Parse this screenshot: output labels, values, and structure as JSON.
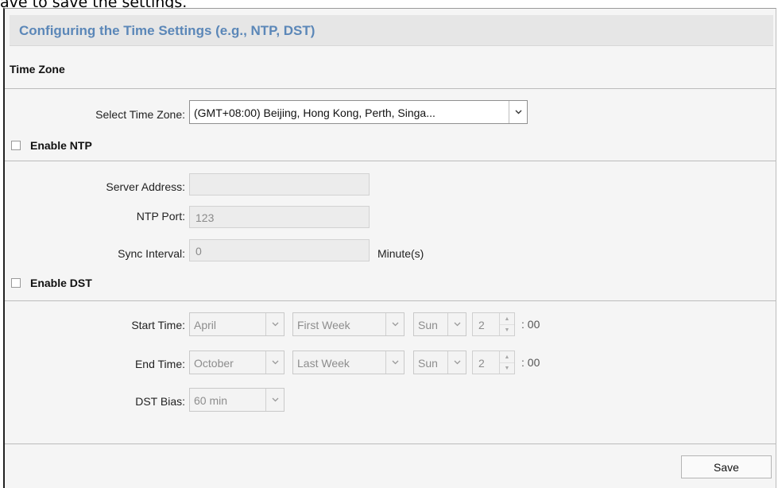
{
  "caption": "ave to save the settings.",
  "header": {
    "title": "Configuring the Time Settings (e.g., NTP, DST)"
  },
  "time_zone": {
    "section_title": "Time Zone",
    "label": "Select Time Zone:",
    "value": "(GMT+08:00) Beijing, Hong Kong, Perth, Singa..."
  },
  "ntp": {
    "checkbox_label": "Enable NTP",
    "checked": false,
    "server_label": "Server Address:",
    "server_value": "",
    "port_label": "NTP Port:",
    "port_value": "123",
    "interval_label": "Sync Interval:",
    "interval_value": "0",
    "interval_unit": "Minute(s)"
  },
  "dst": {
    "checkbox_label": "Enable DST",
    "checked": false,
    "start_label": "Start Time:",
    "start": {
      "month": "April",
      "week": "First Week",
      "day": "Sun",
      "hour": "2",
      "minutes": ": 00"
    },
    "end_label": "End Time:",
    "end": {
      "month": "October",
      "week": "Last Week",
      "day": "Sun",
      "hour": "2",
      "minutes": ": 00"
    },
    "bias_label": "DST Bias:",
    "bias_value": "60 min"
  },
  "footer": {
    "save_label": "Save"
  },
  "colors": {
    "title_blue": "#5b87b8",
    "header_bg": "#e6e6e6",
    "page_bg": "#f5f5f5"
  }
}
